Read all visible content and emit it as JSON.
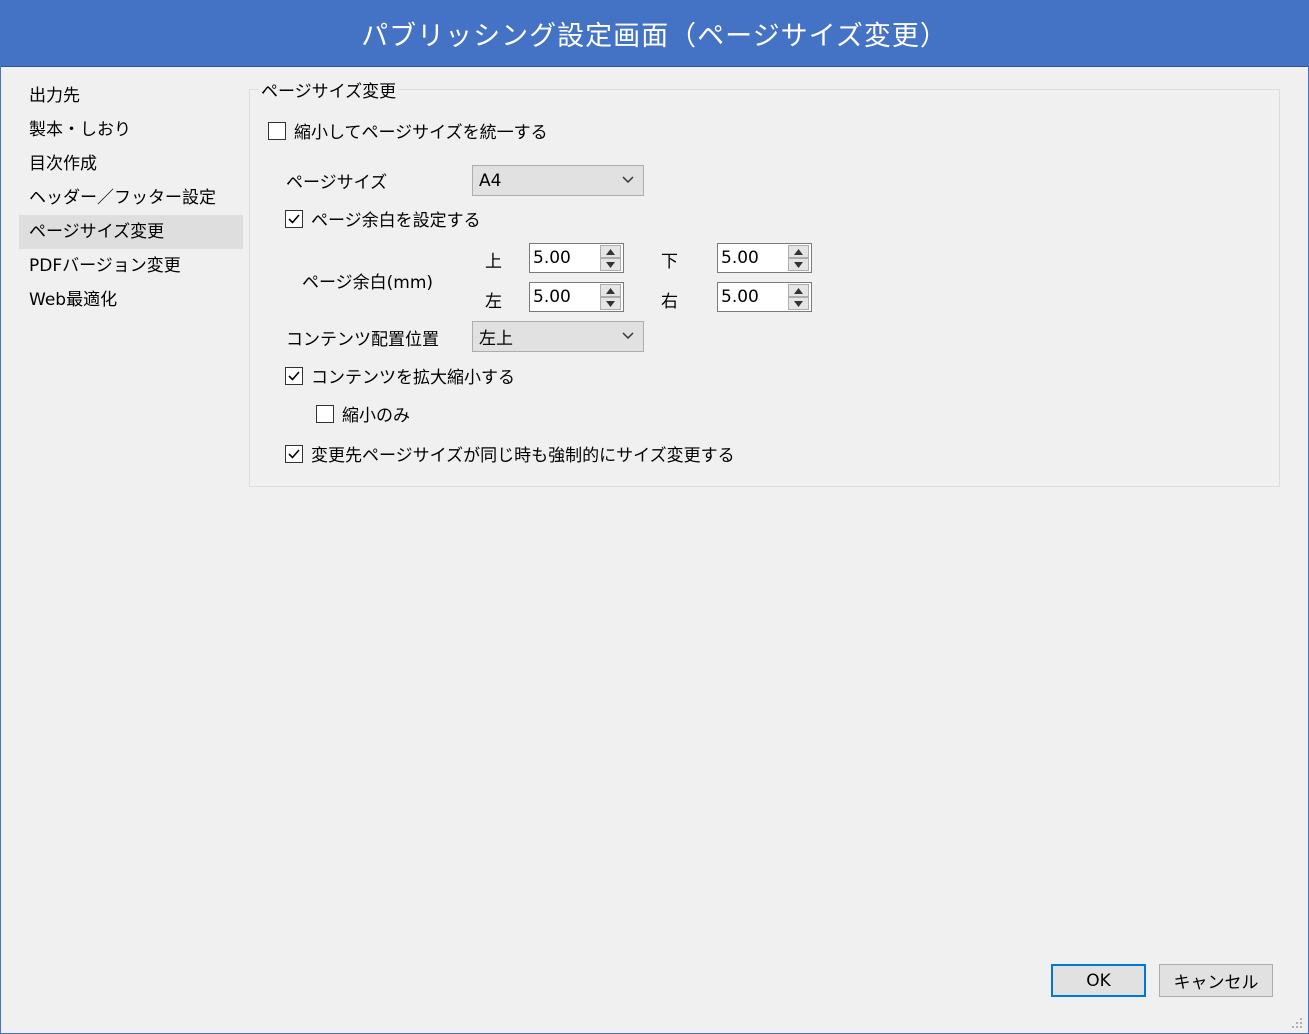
{
  "window": {
    "title": "パブリッシング設定画面（ページサイズ変更）"
  },
  "sidebar": {
    "items": [
      {
        "label": "出力先"
      },
      {
        "label": "製本・しおり"
      },
      {
        "label": "目次作成"
      },
      {
        "label": "ヘッダー／フッター設定"
      },
      {
        "label": "ページサイズ変更",
        "selected": true
      },
      {
        "label": "PDFバージョン変更"
      },
      {
        "label": "Web最適化"
      }
    ]
  },
  "group": {
    "title": "ページサイズ変更",
    "unify_checkbox": {
      "label": "縮小してページサイズを統一する",
      "checked": false
    },
    "page_size": {
      "label": "ページサイズ",
      "value": "A4"
    },
    "margin_checkbox": {
      "label": "ページ余白を設定する",
      "checked": true
    },
    "margin": {
      "label": "ページ余白(mm)",
      "top": {
        "label": "上",
        "value": "5.00"
      },
      "bottom": {
        "label": "下",
        "value": "5.00"
      },
      "left": {
        "label": "左",
        "value": "5.00"
      },
      "right": {
        "label": "右",
        "value": "5.00"
      }
    },
    "content_position": {
      "label": "コンテンツ配置位置",
      "value": "左上"
    },
    "scale_checkbox": {
      "label": "コンテンツを拡大縮小する",
      "checked": true
    },
    "shrink_only_checkbox": {
      "label": "縮小のみ",
      "checked": false
    },
    "force_checkbox": {
      "label": "変更先ページサイズが同じ時も強制的にサイズ変更する",
      "checked": true
    }
  },
  "buttons": {
    "ok": "OK",
    "cancel": "キャンセル"
  },
  "colors": {
    "titlebar": "#4472c4",
    "dialog_bg": "#f0f0f0",
    "focus_border": "#0078d7"
  }
}
